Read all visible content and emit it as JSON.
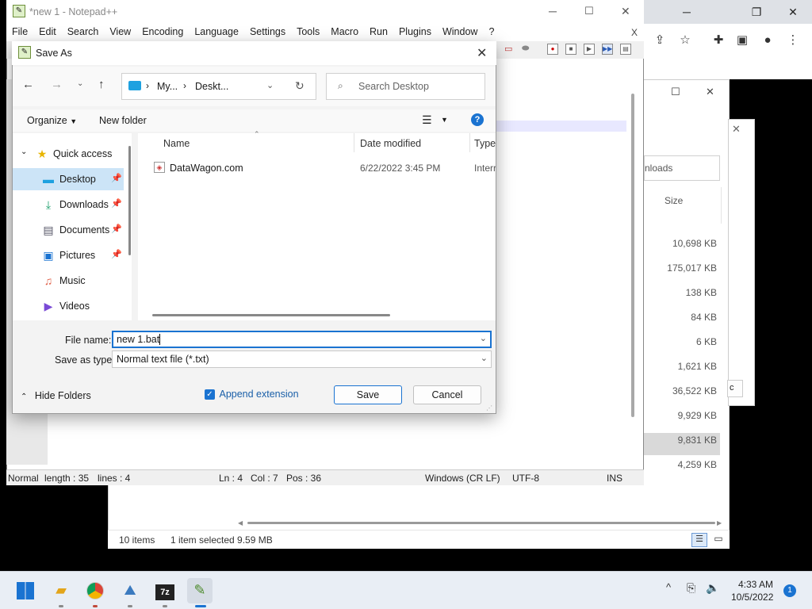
{
  "chrome": {
    "minimize": "─",
    "restore": "❐",
    "close": "✕"
  },
  "explorer": {
    "search_partial": "nloads",
    "col_size": "Size",
    "sizes": [
      "10,698 KB",
      "175,017 KB",
      "138 KB",
      "84 KB",
      "6 KB",
      "1,621 KB",
      "36,522 KB",
      "9,929 KB",
      "9,831 KB",
      "4,259 KB"
    ],
    "status_items": "10 items",
    "status_selected": "1 item selected  9.59 MB",
    "partial_button": "c"
  },
  "notepad": {
    "title": "*new 1 - Notepad++",
    "menu": [
      "File",
      "Edit",
      "Search",
      "View",
      "Encoding",
      "Language",
      "Settings",
      "Tools",
      "Macro",
      "Run",
      "Plugins",
      "Window",
      "?"
    ],
    "close_x": "X",
    "status": {
      "mode": "Normal",
      "length": "length : 35",
      "lines": "lines : 4",
      "ln": "Ln : 4",
      "col": "Col : 7",
      "pos": "Pos : 36",
      "eol": "Windows (CR LF)",
      "encoding": "UTF-8",
      "ins": "INS"
    }
  },
  "dialog": {
    "title": "Save As",
    "address_1": "My...",
    "address_2": "Deskt...",
    "search_placeholder": "Search Desktop",
    "organize": "Organize",
    "new_folder": "New folder",
    "nav_items": [
      {
        "label": "Quick access"
      },
      {
        "label": "Desktop"
      },
      {
        "label": "Downloads"
      },
      {
        "label": "Documents"
      },
      {
        "label": "Pictures"
      },
      {
        "label": "Music"
      },
      {
        "label": "Videos"
      }
    ],
    "columns": {
      "name": "Name",
      "date": "Date modified",
      "type": "Type"
    },
    "files": [
      {
        "name": "DataWagon.com",
        "date": "6/22/2022 3:45 PM",
        "type": "Interr"
      }
    ],
    "file_name_label": "File name:",
    "file_name_value": "new 1.bat",
    "save_type_label": "Save as type:",
    "save_type_value": "Normal text file (*.txt)",
    "hide_folders": "Hide Folders",
    "append_extension": "Append extension",
    "save": "Save",
    "cancel": "Cancel"
  },
  "taskbar": {
    "time": "4:33 AM",
    "date": "10/5/2022",
    "notification_count": "1",
    "tray_chevron": "^"
  }
}
